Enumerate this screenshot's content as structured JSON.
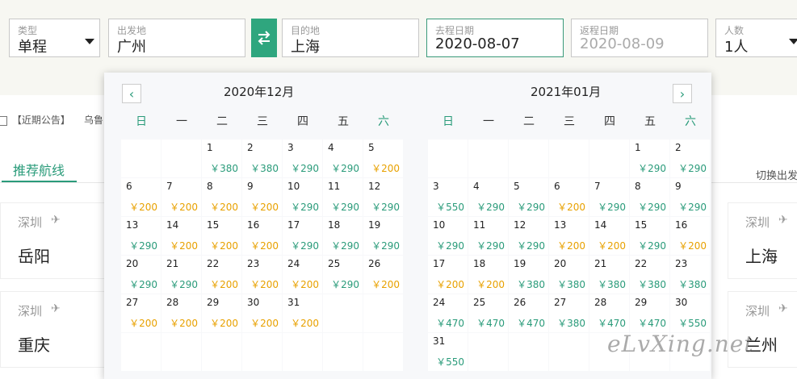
{
  "search": {
    "type": {
      "label": "类型",
      "value": "单程"
    },
    "from": {
      "label": "出发地",
      "value": "广州"
    },
    "to": {
      "label": "目的地",
      "value": "上海"
    },
    "depart": {
      "label": "去程日期",
      "value": "2020-08-07"
    },
    "return": {
      "label": "返程日期",
      "value": "2020-08-09"
    },
    "people": {
      "label": "人数",
      "value": "1人"
    }
  },
  "notice": {
    "label": "【近期公告】",
    "text": "乌鲁"
  },
  "tabs": {
    "recommended": "推荐航线",
    "switch": "切换出发"
  },
  "cards": [
    {
      "from": "深圳",
      "to": "岳阳"
    },
    {
      "from": "深圳",
      "to": "重庆"
    },
    {
      "from": "深圳",
      "to": "上海"
    },
    {
      "from": "深圳",
      "to": "兰州"
    }
  ],
  "weekdays": [
    "日",
    "一",
    "二",
    "三",
    "四",
    "五",
    "六"
  ],
  "calendar": {
    "left": {
      "title": "2020年12月",
      "cells": [
        {
          "d": "",
          "p": "",
          "c": ""
        },
        {
          "d": "",
          "p": "",
          "c": ""
        },
        {
          "d": "1",
          "p": "￥380",
          "c": "g"
        },
        {
          "d": "2",
          "p": "￥380",
          "c": "g"
        },
        {
          "d": "3",
          "p": "￥290",
          "c": "g"
        },
        {
          "d": "4",
          "p": "￥290",
          "c": "g"
        },
        {
          "d": "5",
          "p": "￥200",
          "c": "o"
        },
        {
          "d": "6",
          "p": "￥200",
          "c": "o"
        },
        {
          "d": "7",
          "p": "￥200",
          "c": "o"
        },
        {
          "d": "8",
          "p": "￥200",
          "c": "o"
        },
        {
          "d": "9",
          "p": "￥200",
          "c": "o"
        },
        {
          "d": "10",
          "p": "￥290",
          "c": "g"
        },
        {
          "d": "11",
          "p": "￥290",
          "c": "g"
        },
        {
          "d": "12",
          "p": "￥290",
          "c": "g"
        },
        {
          "d": "13",
          "p": "￥290",
          "c": "g"
        },
        {
          "d": "14",
          "p": "￥200",
          "c": "o"
        },
        {
          "d": "15",
          "p": "￥200",
          "c": "o"
        },
        {
          "d": "16",
          "p": "￥200",
          "c": "o"
        },
        {
          "d": "17",
          "p": "￥290",
          "c": "g"
        },
        {
          "d": "18",
          "p": "￥290",
          "c": "g"
        },
        {
          "d": "19",
          "p": "￥290",
          "c": "g"
        },
        {
          "d": "20",
          "p": "￥290",
          "c": "g"
        },
        {
          "d": "21",
          "p": "￥290",
          "c": "g"
        },
        {
          "d": "22",
          "p": "￥200",
          "c": "o"
        },
        {
          "d": "23",
          "p": "￥200",
          "c": "o"
        },
        {
          "d": "24",
          "p": "￥200",
          "c": "o"
        },
        {
          "d": "25",
          "p": "￥290",
          "c": "g"
        },
        {
          "d": "26",
          "p": "￥200",
          "c": "o"
        },
        {
          "d": "27",
          "p": "￥200",
          "c": "o"
        },
        {
          "d": "28",
          "p": "￥200",
          "c": "o"
        },
        {
          "d": "29",
          "p": "￥200",
          "c": "o"
        },
        {
          "d": "30",
          "p": "￥200",
          "c": "o"
        },
        {
          "d": "31",
          "p": "￥200",
          "c": "o"
        },
        {
          "d": "",
          "p": "",
          "c": ""
        },
        {
          "d": "",
          "p": "",
          "c": ""
        },
        {
          "d": "",
          "p": "",
          "c": ""
        },
        {
          "d": "",
          "p": "",
          "c": ""
        },
        {
          "d": "",
          "p": "",
          "c": ""
        },
        {
          "d": "",
          "p": "",
          "c": ""
        },
        {
          "d": "",
          "p": "",
          "c": ""
        },
        {
          "d": "",
          "p": "",
          "c": ""
        },
        {
          "d": "",
          "p": "",
          "c": ""
        }
      ]
    },
    "right": {
      "title": "2021年01月",
      "cells": [
        {
          "d": "",
          "p": "",
          "c": ""
        },
        {
          "d": "",
          "p": "",
          "c": ""
        },
        {
          "d": "",
          "p": "",
          "c": ""
        },
        {
          "d": "",
          "p": "",
          "c": ""
        },
        {
          "d": "",
          "p": "",
          "c": ""
        },
        {
          "d": "1",
          "p": "￥290",
          "c": "g"
        },
        {
          "d": "2",
          "p": "￥290",
          "c": "g"
        },
        {
          "d": "3",
          "p": "￥550",
          "c": "g"
        },
        {
          "d": "4",
          "p": "￥290",
          "c": "g"
        },
        {
          "d": "5",
          "p": "￥290",
          "c": "g"
        },
        {
          "d": "6",
          "p": "￥200",
          "c": "o"
        },
        {
          "d": "7",
          "p": "￥290",
          "c": "g"
        },
        {
          "d": "8",
          "p": "￥290",
          "c": "g"
        },
        {
          "d": "9",
          "p": "￥290",
          "c": "g"
        },
        {
          "d": "10",
          "p": "￥290",
          "c": "g"
        },
        {
          "d": "11",
          "p": "￥290",
          "c": "g"
        },
        {
          "d": "12",
          "p": "￥290",
          "c": "g"
        },
        {
          "d": "13",
          "p": "￥200",
          "c": "o"
        },
        {
          "d": "14",
          "p": "￥200",
          "c": "o"
        },
        {
          "d": "15",
          "p": "￥290",
          "c": "g"
        },
        {
          "d": "16",
          "p": "￥200",
          "c": "o"
        },
        {
          "d": "17",
          "p": "￥200",
          "c": "o"
        },
        {
          "d": "18",
          "p": "￥200",
          "c": "o"
        },
        {
          "d": "19",
          "p": "￥380",
          "c": "g"
        },
        {
          "d": "20",
          "p": "￥380",
          "c": "g"
        },
        {
          "d": "21",
          "p": "￥380",
          "c": "g"
        },
        {
          "d": "22",
          "p": "￥380",
          "c": "g"
        },
        {
          "d": "23",
          "p": "￥380",
          "c": "g"
        },
        {
          "d": "24",
          "p": "￥470",
          "c": "g"
        },
        {
          "d": "25",
          "p": "￥470",
          "c": "g"
        },
        {
          "d": "26",
          "p": "￥470",
          "c": "g"
        },
        {
          "d": "27",
          "p": "￥380",
          "c": "g"
        },
        {
          "d": "28",
          "p": "￥470",
          "c": "g"
        },
        {
          "d": "29",
          "p": "￥470",
          "c": "g"
        },
        {
          "d": "30",
          "p": "￥550",
          "c": "g"
        },
        {
          "d": "31",
          "p": "￥550",
          "c": "g"
        },
        {
          "d": "",
          "p": "",
          "c": ""
        },
        {
          "d": "",
          "p": "",
          "c": ""
        },
        {
          "d": "",
          "p": "",
          "c": ""
        },
        {
          "d": "",
          "p": "",
          "c": ""
        },
        {
          "d": "",
          "p": "",
          "c": ""
        },
        {
          "d": "",
          "p": "",
          "c": ""
        }
      ]
    }
  },
  "watermark": "eLvXing.net",
  "colors": {
    "accent": "#2a9b7a",
    "price_high": "#2a9b7a",
    "price_low": "#e8a100"
  }
}
